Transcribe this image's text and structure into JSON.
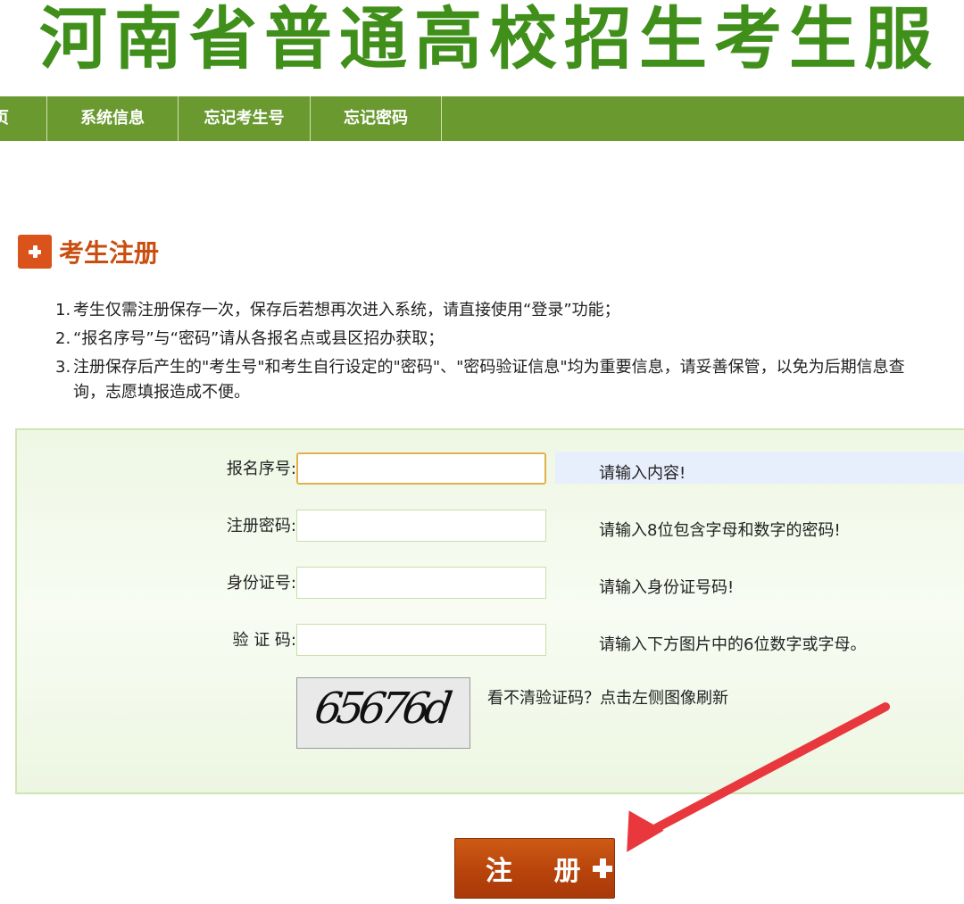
{
  "header": {
    "site_title": "河南省普通高校招生考生服"
  },
  "nav": {
    "items": [
      {
        "label": "页"
      },
      {
        "label": "系统信息"
      },
      {
        "label": "忘记考生号"
      },
      {
        "label": "忘记密码"
      }
    ]
  },
  "section": {
    "title": "考生注册"
  },
  "notes": [
    {
      "num": "1.",
      "text": "考生仅需注册保存一次，保存后若想再次进入系统，请直接使用“登录”功能；"
    },
    {
      "num": "2.",
      "text": "“报名序号”与“密码”请从各报名点或县区招办获取；"
    },
    {
      "num": "3.",
      "text": "注册保存后产生的\"考生号\"和考生自行设定的\"密码\"、\"密码验证信息\"均为重要信息，请妥善保管，以免为后期信息查询，志愿填报造成不便。"
    }
  ],
  "form": {
    "rows": [
      {
        "label": "报名序号:",
        "value": "",
        "hint": "请输入内容!"
      },
      {
        "label": "注册密码:",
        "value": "",
        "hint": "请输入8位包含字母和数字的密码!"
      },
      {
        "label": "身份证号:",
        "value": "",
        "hint": "请输入身份证号码!"
      },
      {
        "label": "验 证 码:",
        "value": "",
        "hint": "请输入下方图片中的6位数字或字母。"
      }
    ],
    "captcha_text": "65676d",
    "captcha_tip": "看不清验证码？点击左侧图像刷新"
  },
  "submit": {
    "label": "注 册"
  },
  "colors": {
    "title_green": "#3f8f1a",
    "nav_green": "#6a9a2f",
    "accent_orange": "#c94e10",
    "arrow_red": "#e8373d"
  },
  "icons": {
    "section_icon": "plus-icon",
    "submit_icon": "plus-icon",
    "annotation": "red-arrow"
  }
}
